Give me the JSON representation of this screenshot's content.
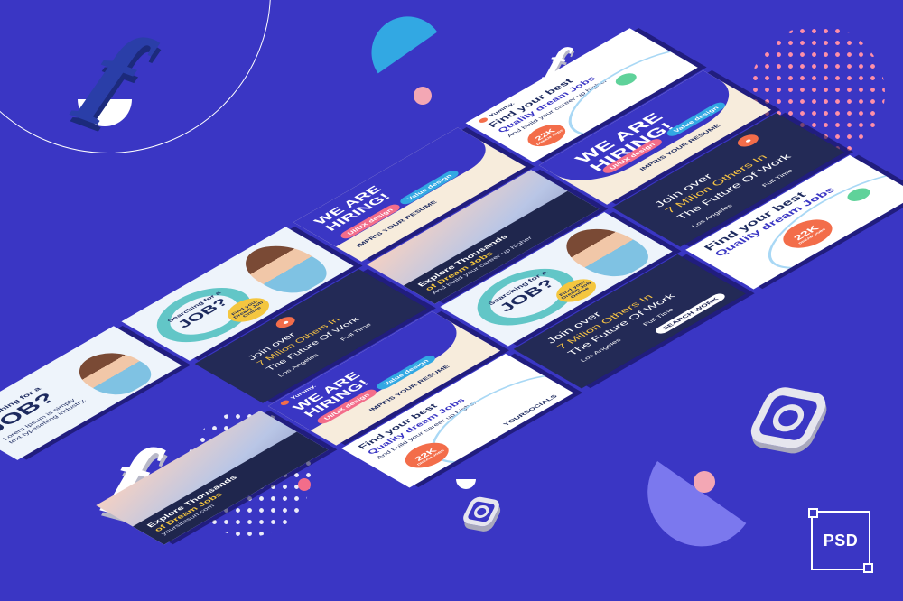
{
  "badge": {
    "label": "PSD"
  },
  "tiles": {
    "hiring_title": "WE ARE HIRING!",
    "hiring_tag1": "UI/UX design",
    "hiring_tag2": "Value design",
    "hiring_cta": "IMPRIS YOUR RESUME",
    "job_kicker": "Searching for a",
    "job_title": "JOB?",
    "job_badge": "Find your Dream Job Online",
    "lorem": "Lorem Ipsum is simply text typesetting industry.",
    "explore_line1": "Explore Thousands",
    "explore_line2": "of Dream Jobs",
    "explore_sub": "And build your career up higher",
    "explore_url": "yoursitesurl.com",
    "dream_line1": "Find your best",
    "dream_line2": "Quality dream Jobs",
    "dream_sub": "And build your career up higher",
    "dream_count": "22K",
    "dream_count_sub": "DREAM JOBS",
    "join_line1": "Join over",
    "join_line2": "7 Milion Others In",
    "join_line3": "The Future Of Work",
    "join_place": "Los Angeles",
    "join_type": "Full Time",
    "join_cta": "SEARCH WORK",
    "brand": "Yummy.",
    "social": "YOURSOCIALS"
  },
  "colors": {
    "background": "#3a36c4",
    "navy": "#232a56",
    "accent_orange": "#f36d4a",
    "accent_yellow": "#f4c63f",
    "accent_teal": "#62c6c7"
  }
}
